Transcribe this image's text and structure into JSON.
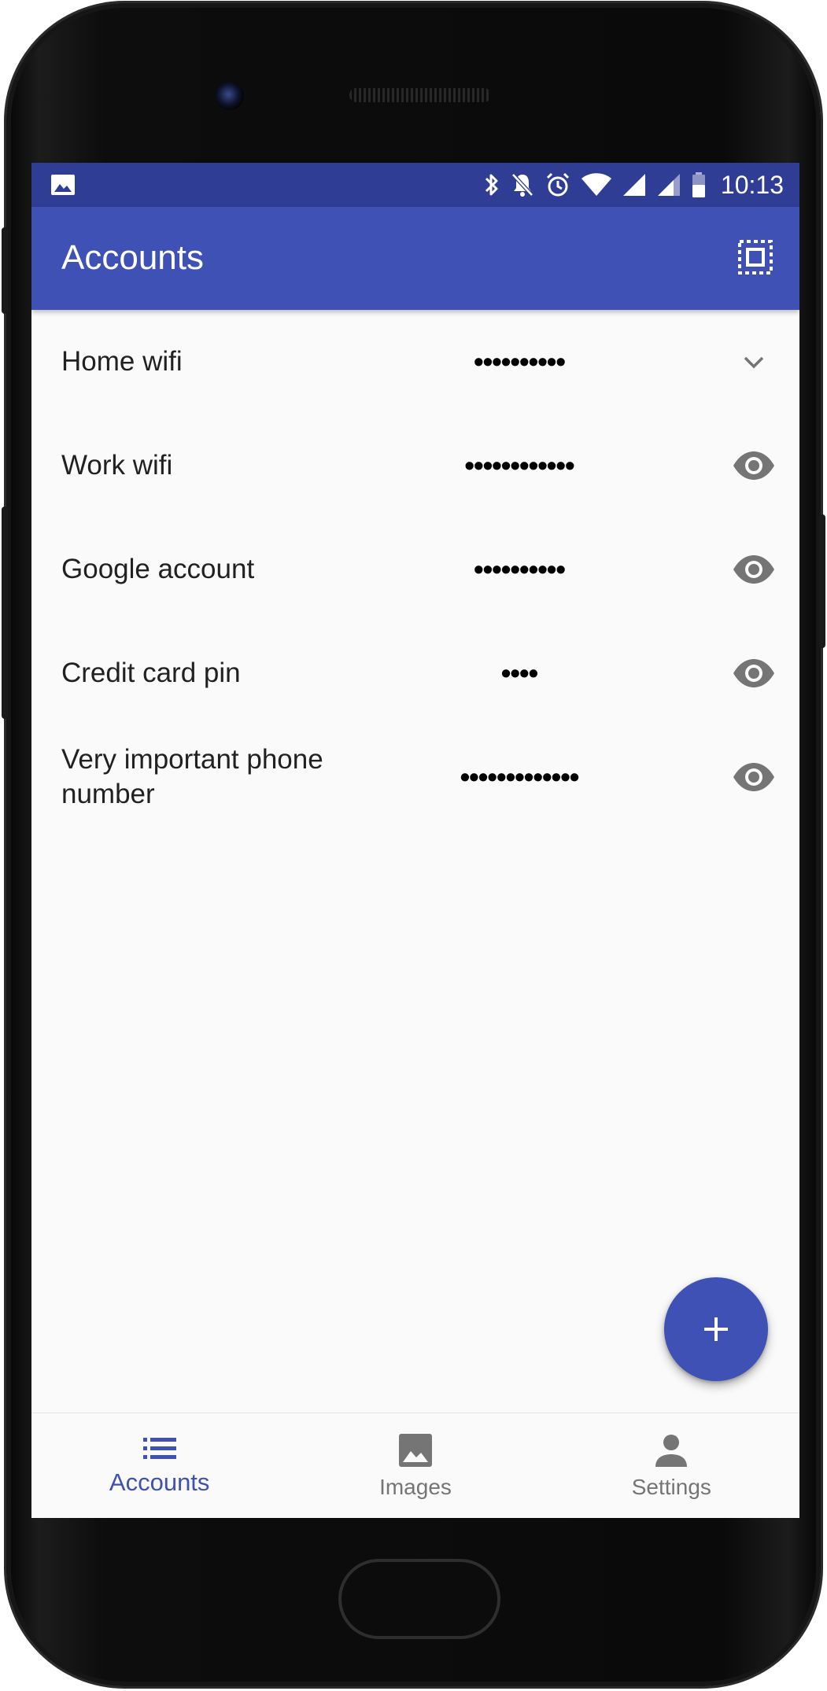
{
  "status_bar": {
    "time": "10:13"
  },
  "app_bar": {
    "title": "Accounts"
  },
  "accounts": [
    {
      "name": "Home wifi",
      "secret": "••••••••••",
      "action_icon": "chevron-down-icon"
    },
    {
      "name": "Work wifi",
      "secret": "••••••••••••",
      "action_icon": "eye-icon"
    },
    {
      "name": "Google account",
      "secret": "••••••••••",
      "action_icon": "eye-icon"
    },
    {
      "name": "Credit card pin",
      "secret": "••••",
      "action_icon": "eye-icon"
    },
    {
      "name": "Very important phone number",
      "secret": "•••••••••••••",
      "action_icon": "eye-icon"
    }
  ],
  "fab": {
    "icon": "plus-icon"
  },
  "bottom_nav": {
    "items": [
      {
        "label": "Accounts",
        "icon": "list-icon",
        "active": true
      },
      {
        "label": "Images",
        "icon": "image-icon",
        "active": false
      },
      {
        "label": "Settings",
        "icon": "person-icon",
        "active": false
      }
    ]
  },
  "colors": {
    "primary": "#3f51b5",
    "primary_dark": "#2f3d94",
    "background": "#fafafa",
    "icon_gray": "#757575"
  }
}
